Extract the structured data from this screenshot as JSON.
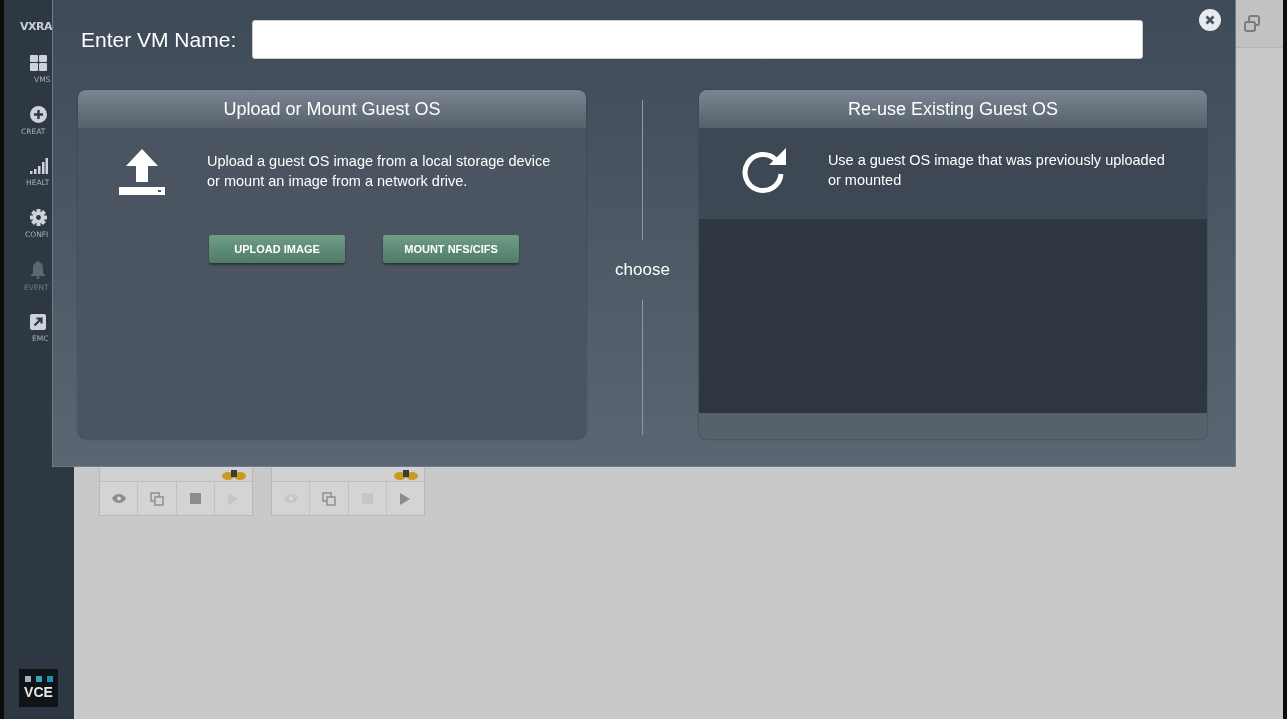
{
  "sidebar": {
    "logo": "VXRA",
    "items": [
      {
        "kind": "vms",
        "label": "VMS",
        "disabled": false
      },
      {
        "kind": "create",
        "label": "CREAT",
        "disabled": false
      },
      {
        "kind": "health",
        "label": "HEALT",
        "disabled": false
      },
      {
        "kind": "config",
        "label": "CONFI",
        "disabled": false
      },
      {
        "kind": "events",
        "label": "EVENT",
        "disabled": true
      },
      {
        "kind": "emc",
        "label": "EMC",
        "disabled": false
      }
    ],
    "footer_logo": "VCE"
  },
  "vm_cards": [
    {
      "actions": [
        {
          "kind": "view",
          "disabled": false
        },
        {
          "kind": "clone",
          "disabled": false
        },
        {
          "kind": "stop",
          "disabled": false
        },
        {
          "kind": "start",
          "disabled": true
        }
      ]
    },
    {
      "actions": [
        {
          "kind": "view",
          "disabled": true
        },
        {
          "kind": "clone",
          "disabled": false
        },
        {
          "kind": "stop",
          "disabled": true
        },
        {
          "kind": "start",
          "disabled": false
        }
      ]
    }
  ],
  "dialog": {
    "name_label": "Enter VM Name:",
    "options": [
      {
        "kind": "upload",
        "title": "Upload or Mount Guest OS",
        "description": "Upload a guest OS image from a local storage device\nor mount an image from a network drive.",
        "buttons": [
          "UPLOAD IMAGE",
          "MOUNT NFS/CIFS"
        ]
      },
      {
        "kind": "reuse",
        "title": "Re-use Existing Guest OS",
        "description": "Use a guest OS image that was previously uploaded\nor mounted"
      }
    ],
    "separator": "choose"
  }
}
